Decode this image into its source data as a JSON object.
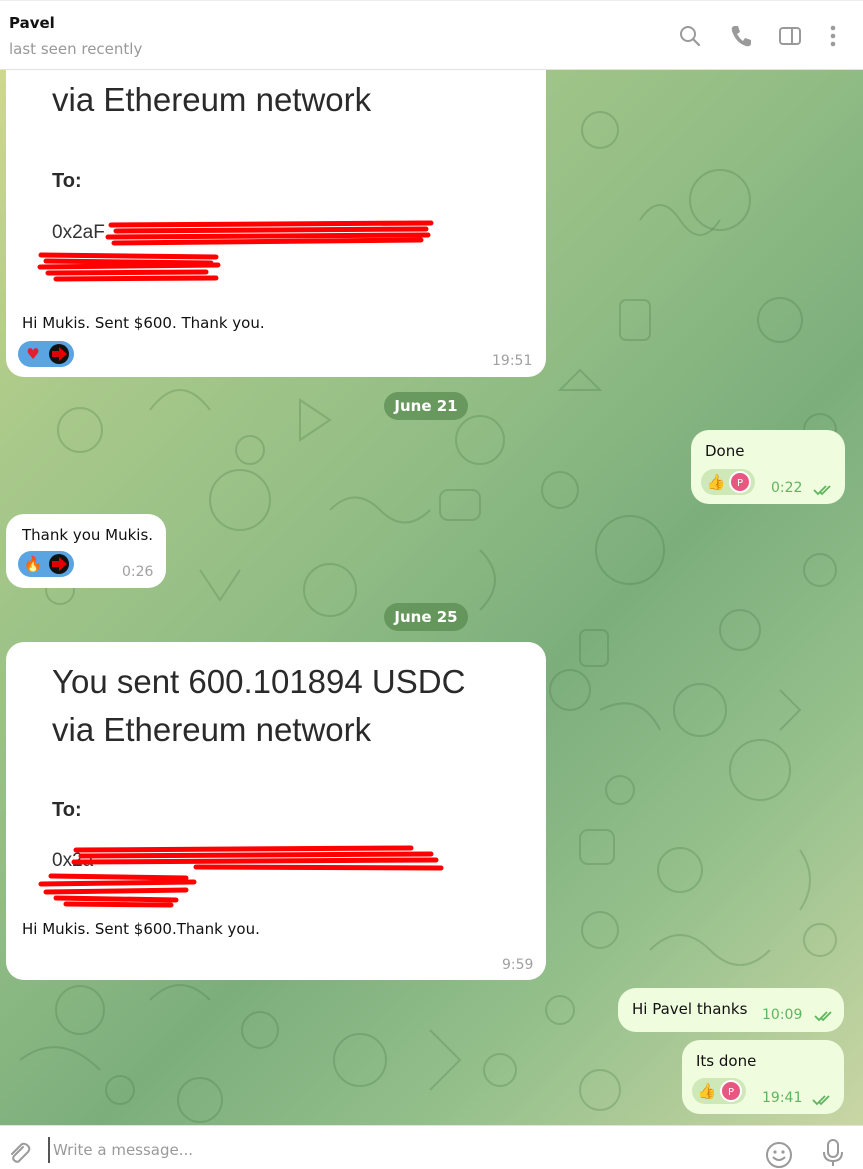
{
  "header": {
    "name": "Pavel",
    "status": "last seen recently"
  },
  "messages": {
    "m1": {
      "big_line_2": "via Ethereum network",
      "to_label": "To:",
      "address_visible": "0x2aF",
      "caption": "Hi Mukis. Sent $600. Thank you.",
      "time": "19:51",
      "reactions": [
        "heart",
        "arrow"
      ]
    },
    "date1": "June 21",
    "m2": {
      "text": "Done",
      "time": "0:22",
      "reactions": [
        "thumbs-up",
        "P"
      ]
    },
    "m3": {
      "text": "Thank you Mukis.",
      "time": "0:26",
      "reactions": [
        "fire",
        "arrow"
      ]
    },
    "date2": "June 25",
    "m4": {
      "big_line_1": "You sent 600.101894 USDC",
      "big_line_2": "via Ethereum network",
      "to_label": "To:",
      "address_visible": "0x2a",
      "caption": "Hi Mukis. Sent $600.Thank you.",
      "time": "9:59"
    },
    "m5": {
      "text": "Hi Pavel thanks",
      "time": "10:09"
    },
    "m6": {
      "text": "Its done",
      "time": "19:41",
      "reactions": [
        "thumbs-up",
        "P"
      ]
    }
  },
  "composer": {
    "placeholder": "Write a message..."
  },
  "colors": {
    "incoming_bubble": "#ffffff",
    "outgoing_bubble": "#effdde",
    "time_outgoing": "#5eb55e",
    "redaction": "#ff0000",
    "date_pill": "#5a8c50"
  },
  "icons": [
    "search-icon",
    "phone-icon",
    "sidebar-toggle-icon",
    "more-icon",
    "attach-icon",
    "emoji-icon",
    "microphone-icon",
    "double-check-icon"
  ]
}
